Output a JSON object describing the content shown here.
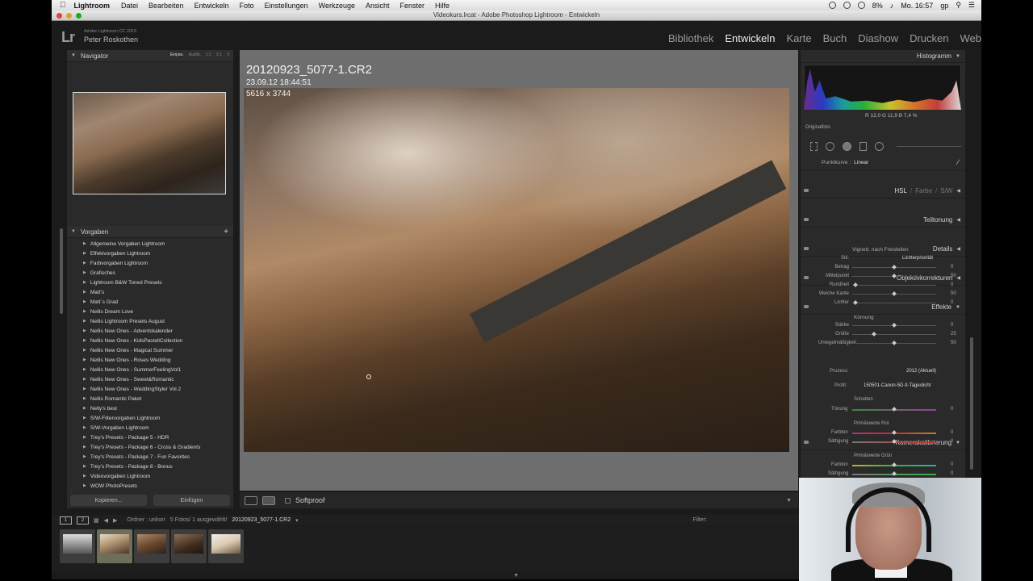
{
  "menubar": {
    "app": "Lightroom",
    "items": [
      "Datei",
      "Bearbeiten",
      "Entwickeln",
      "Foto",
      "Einstellungen",
      "Werkzeuge",
      "Ansicht",
      "Fenster",
      "Hilfe"
    ],
    "battery": "8%",
    "clock": "Mo. 16:57",
    "user": "gp"
  },
  "window": {
    "title": "Videokurs.lrcat - Adobe Photoshop Lightroom - Entwickeln"
  },
  "identity": {
    "logo": "Lr",
    "product": "Adobe Lightroom CC 2015",
    "name": "Peter Roskothen"
  },
  "modules": [
    "Bibliothek",
    "Entwickeln",
    "Karte",
    "Buch",
    "Diashow",
    "Drucken",
    "Web"
  ],
  "active_module": "Entwickeln",
  "navigator": {
    "title": "Navigator",
    "options": [
      "Einpas.",
      "Ausfül.",
      "1:1",
      "2:1"
    ],
    "selected_option": "Einpas."
  },
  "presets": {
    "title": "Vorgaben",
    "add": "+",
    "items": [
      "Allgemeine Vorgaben Lightroom",
      "Effektvorgaben Lightroom",
      "Farbvorgaben Lightroom",
      "Grafisches",
      "Lightroom B&W Toned Presets",
      "Matt's",
      "Matt´s Grad",
      "Nellis Dream Love",
      "Nellis Lightroom Presets August",
      "Nellis New Ones - Adventskalender",
      "Nellis New Ones - KidsPastellCollection",
      "Nellis New Ones - Magical Summer",
      "Nellis New Ones - Roses Wedding",
      "Nellis New Ones - SummerFeelingVol1",
      "Nellis New Ones - Sweet&Romantic",
      "Nellis New Ones - WeddingStyler Vol.2",
      "Nellis Romantic Paket",
      "Nelly's best",
      "S/W-Filtervorgaben Lightroom",
      "S/W-Vorgaben Lightroom",
      "Trey's Presets - Package 5 - HDR",
      "Trey's Presets - Package 6 - Cross & Gradients",
      "Trey's Presets - Package 7 - Fun Favorites",
      "Trey's Presets - Package 8 - Bonus",
      "Videovorgaben Lightroom",
      "WOW PhotoPresets"
    ]
  },
  "left_buttons": {
    "copy": "Kopieren...",
    "paste": "Einfügen"
  },
  "photo": {
    "filename": "20120923_5077-1.CR2",
    "date": "23.09.12 18:44:51",
    "dimensions": "5616 x 3744"
  },
  "toolbar": {
    "softproof": "Softproof"
  },
  "right_panel": {
    "histogram": "Histogramm",
    "hist_values": "R  12,0  G  11,9  B  7,4 %",
    "original": "Originalfoto",
    "point_curve_label": "Punktkurve :",
    "point_curve_value": "Linear",
    "hsl": "HSL",
    "farbe": "Farbe",
    "sw": "S/W",
    "teiltonung": "Teiltonung",
    "details": "Details",
    "objektiv": "Objektivkorrekturen",
    "effekte": "Effekte",
    "vignette_title": "Vignett. nach Freistellen",
    "stil_label": "Stil:",
    "stil_value": "Lichterpriorität",
    "vignette_sliders": [
      {
        "label": "Betrag",
        "value": "0"
      },
      {
        "label": "Mittelpunkt",
        "value": "50"
      },
      {
        "label": "Rundheit",
        "value": "0"
      },
      {
        "label": "Weiche Kante",
        "value": "50"
      },
      {
        "label": "Lichter",
        "value": "0"
      }
    ],
    "koernung_title": "Körnung",
    "koernung_sliders": [
      {
        "label": "Stärke",
        "value": "0"
      },
      {
        "label": "Größe",
        "value": "25"
      },
      {
        "label": "Unregelmäßigkeit",
        "value": "50"
      }
    ],
    "kamerakal": "Kamerakalibrierung",
    "prozess_label": "Prozess:",
    "prozess_value": "2012 (Aktuell)",
    "profil_label": "Profil:",
    "profil_value": "150501-Canon-5D-II-Tageslicht",
    "schatten": "Schatten",
    "toenung_label": "Tönung",
    "toenung_value": "0",
    "primaer_rot": "Primärwerte Rot",
    "primaer_gruen": "Primärwerte Grün",
    "farbton": "Farbton",
    "saettigung": "Sättigung",
    "zero": "0"
  },
  "filmstrip": {
    "screen1": "1",
    "screen2": "2",
    "source": "Ordner : unkorr",
    "count": "5 Fotos/ 1 ausgewählt/",
    "current": "20120923_5077-1.CR2",
    "filter": "Filter:"
  }
}
